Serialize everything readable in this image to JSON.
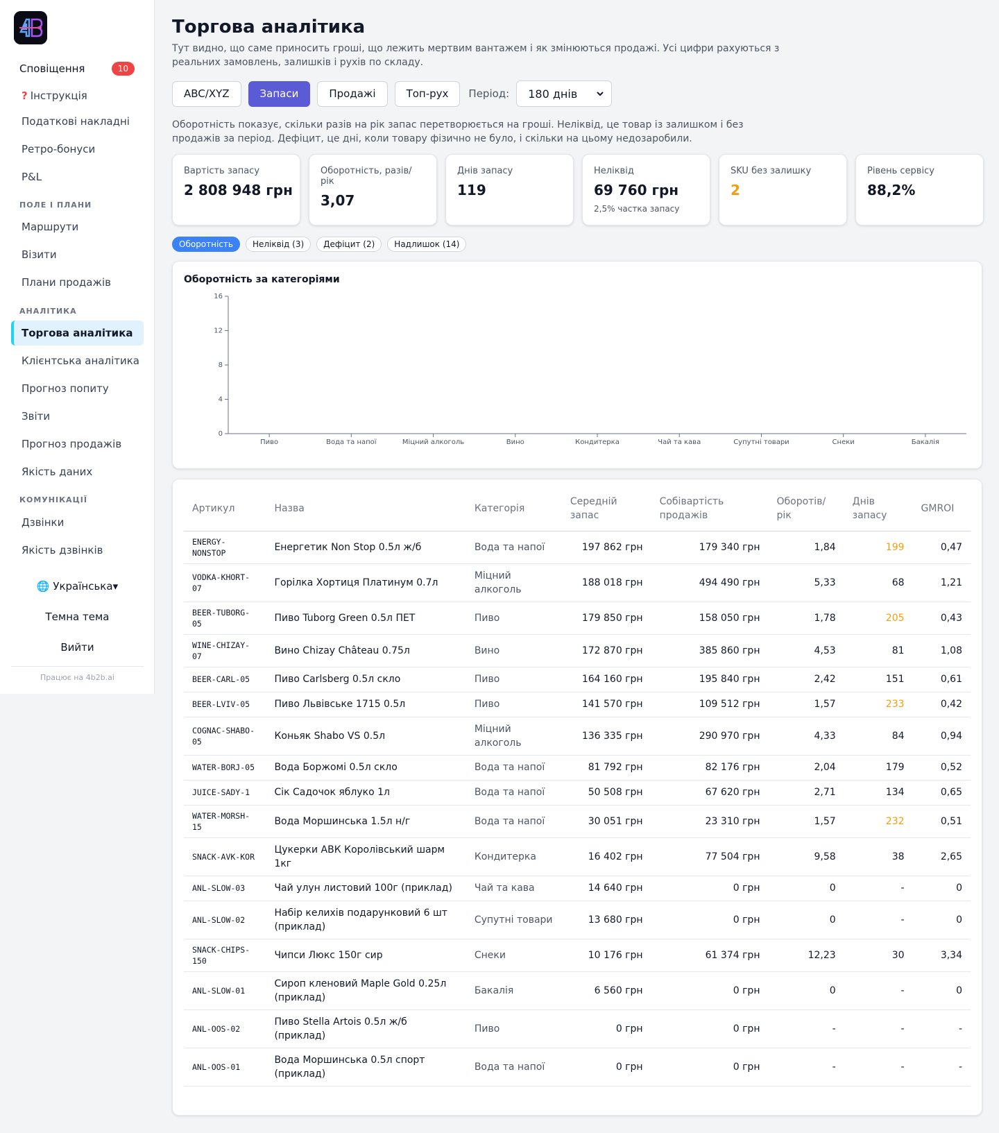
{
  "sidebar": {
    "notifications_label": "Сповіщення",
    "notifications_count": "10",
    "top_items": [
      {
        "label": "Інструкція",
        "icon": "question-icon"
      },
      {
        "label": "Податкові накладні"
      },
      {
        "label": "Ретро-бонуси"
      },
      {
        "label": "P&L"
      }
    ],
    "section_field": "ПОЛЕ І ПЛАНИ",
    "field_items": [
      "Маршрути",
      "Візити",
      "Плани продажів"
    ],
    "section_analytics": "АНАЛІТИКА",
    "analytics_items": [
      "Торгова аналітика",
      "Клієнтська аналітика",
      "Прогноз попиту",
      "Звіти",
      "Прогноз продажів",
      "Якість даних"
    ],
    "section_comms": "КОМУНІКАЦІЇ",
    "comms_items": [
      "Дзвінки",
      "Якість дзвінків"
    ],
    "language": "🌐 Українська▾",
    "theme": "Темна тема",
    "logout": "Вийти",
    "powered": "Працює на 4b2b.ai"
  },
  "page": {
    "title": "Торгова аналітика",
    "subtitle": "Тут видно, що саме приносить гроші, що лежить мертвим вантажем і як змінюються продажі. Усі цифри рахуються з реальних замовлень, залишків і рухів по складу.",
    "tabs": [
      "ABC/XYZ",
      "Запаси",
      "Продажі",
      "Топ-рух"
    ],
    "period_label": "Період:",
    "period_value": "180 днів",
    "description": "Оборотність показує, скільки разів на рік запас перетворюється на гроші. Неліквід, це товар із залишком і без продажів за період. Дефіцит, це дні, коли товару фізично не було, і скільки на цьому недозаробили."
  },
  "kpis": [
    {
      "label": "Вартість запасу",
      "value": "2 808 948 грн",
      "sub": ""
    },
    {
      "label": "Оборотність, разів/рік",
      "value": "3,07",
      "sub": ""
    },
    {
      "label": "Днів запасу",
      "value": "119",
      "sub": ""
    },
    {
      "label": "Неліквід",
      "value": "69 760 грн",
      "sub": "2,5% частка запасу"
    },
    {
      "label": "SKU без залишку",
      "value": "2",
      "sub": ""
    },
    {
      "label": "Рівень сервісу",
      "value": "88,2%",
      "sub": ""
    }
  ],
  "chips": [
    "Оборотність",
    "Неліквід (3)",
    "Дефіцит (2)",
    "Надлишок (14)"
  ],
  "chart_data": {
    "type": "bar",
    "title": "Оборотність за категоріями",
    "categories": [
      "Пиво",
      "Вода та напої",
      "Міцний алкоголь",
      "Вино",
      "Кондитерка",
      "Чай та кава",
      "Супутні товари",
      "Снеки",
      "Бакалія"
    ],
    "values": [
      0,
      0,
      0,
      0,
      0,
      0,
      0,
      0,
      0
    ],
    "yticks": [
      "0",
      "4",
      "8",
      "12",
      "16"
    ],
    "ylim": [
      0,
      16
    ],
    "xlabel": "",
    "ylabel": ""
  },
  "table": {
    "headers": [
      "Артикул",
      "Назва",
      "Категорія",
      "Середній запас",
      "Собівартість продажів",
      "Оборотів/ рік",
      "Днів запасу",
      "GMROI"
    ],
    "rows": [
      [
        "ENERGY-NONSTOP",
        "Енергетик Non Stop 0.5л ж/б",
        "Вода та напої",
        "197 862 грн",
        "179 340 грн",
        "1,84",
        "199",
        "0,47"
      ],
      [
        "VODKA-KHORT-07",
        "Горілка Хортиця Платинум 0.7л",
        "Міцний алкоголь",
        "188 018 грн",
        "494 490 грн",
        "5,33",
        "68",
        "1,21"
      ],
      [
        "BEER-TUBORG-05",
        "Пиво Tuborg Green 0.5л ПЕТ",
        "Пиво",
        "179 850 грн",
        "158 050 грн",
        "1,78",
        "205",
        "0,43"
      ],
      [
        "WINE-CHIZAY-07",
        "Вино Chizay Château 0.75л",
        "Вино",
        "172 870 грн",
        "385 860 грн",
        "4,53",
        "81",
        "1,08"
      ],
      [
        "BEER-CARL-05",
        "Пиво Carlsberg 0.5л скло",
        "Пиво",
        "164 160 грн",
        "195 840 грн",
        "2,42",
        "151",
        "0,61"
      ],
      [
        "BEER-LVIV-05",
        "Пиво Львівське 1715 0.5л",
        "Пиво",
        "141 570 грн",
        "109 512 грн",
        "1,57",
        "233",
        "0,42"
      ],
      [
        "COGNAC-SHABO-05",
        "Коньяк Shabo VS 0.5л",
        "Міцний алкоголь",
        "136 335 грн",
        "290 970 грн",
        "4,33",
        "84",
        "0,94"
      ],
      [
        "WATER-BORJ-05",
        "Вода Боржомі 0.5л скло",
        "Вода та напої",
        "81 792 грн",
        "82 176 грн",
        "2,04",
        "179",
        "0,52"
      ],
      [
        "JUICE-SADY-1",
        "Сік Садочок яблуко 1л",
        "Вода та напої",
        "50 508 грн",
        "67 620 грн",
        "2,71",
        "134",
        "0,65"
      ],
      [
        "WATER-MORSH-15",
        "Вода Моршинська 1.5л н/г",
        "Вода та напої",
        "30 051 грн",
        "23 310 грн",
        "1,57",
        "232",
        "0,51"
      ],
      [
        "SNACK-AVK-KOR",
        "Цукерки АВК Королівський шарм 1кг",
        "Кондитерка",
        "16 402 грн",
        "77 504 грн",
        "9,58",
        "38",
        "2,65"
      ],
      [
        "ANL-SLOW-03",
        "Чай улун листовий 100г (приклад)",
        "Чай та кава",
        "14 640 грн",
        "0 грн",
        "0",
        "-",
        "0"
      ],
      [
        "ANL-SLOW-02",
        "Набір келихів подарунковий 6 шт (приклад)",
        "Супутні товари",
        "13 680 грн",
        "0 грн",
        "0",
        "-",
        "0"
      ],
      [
        "SNACK-CHIPS-150",
        "Чипси Люкс 150г сир",
        "Снеки",
        "10 176 грн",
        "61 374 грн",
        "12,23",
        "30",
        "3,34"
      ],
      [
        "ANL-SLOW-01",
        "Сироп кленовий Maple Gold 0.25л (приклад)",
        "Бакалія",
        "6 560 грн",
        "0 грн",
        "0",
        "-",
        "0"
      ],
      [
        "ANL-OOS-02",
        "Пиво Stella Artois 0.5л ж/б (приклад)",
        "Пиво",
        "0 грн",
        "0 грн",
        "-",
        "-",
        "-"
      ],
      [
        "ANL-OOS-01",
        "Вода Моршинська 0.5л спорт (приклад)",
        "Вода та напої",
        "0 грн",
        "0 грн",
        "-",
        "-",
        "-"
      ]
    ],
    "warn_days": [
      "199",
      "205",
      "233",
      "232"
    ]
  },
  "colors": {
    "accent": "#5b5bd6",
    "chip_active": "#3b82f6",
    "warn": "#f59e0b",
    "badge": "#ef4444",
    "active_nav_border": "#22d3ee"
  }
}
